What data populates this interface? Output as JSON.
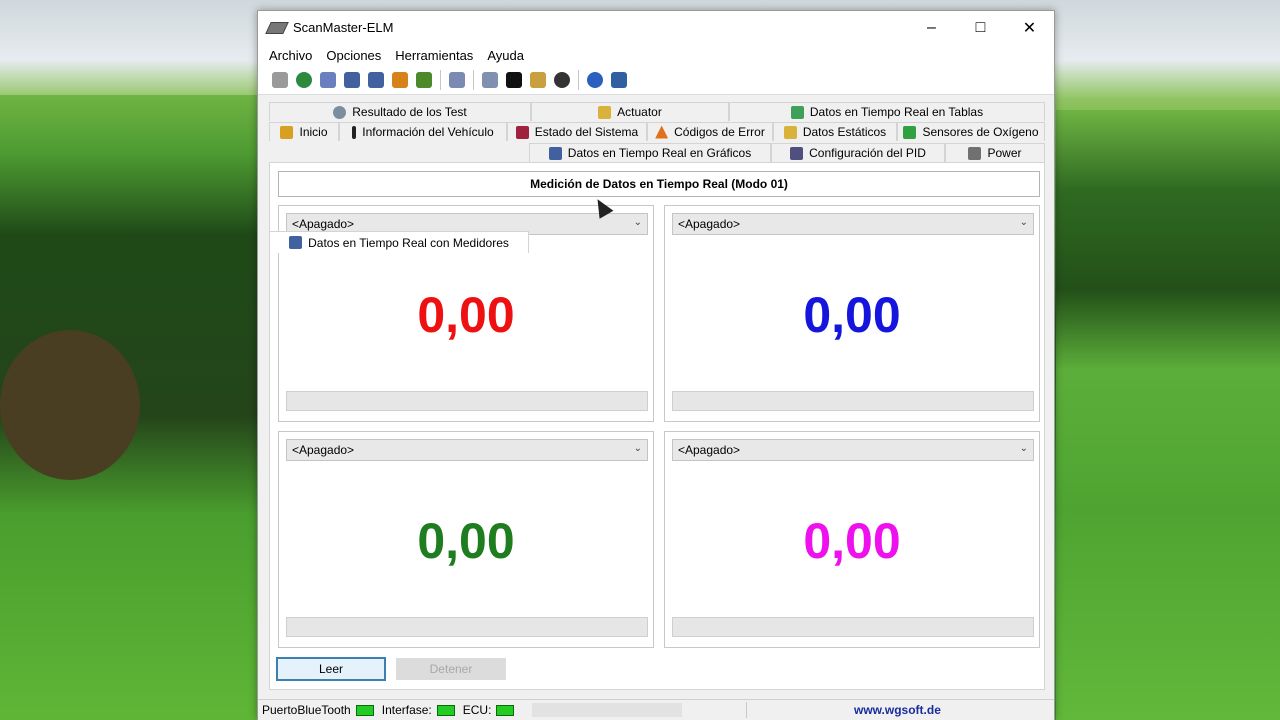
{
  "window": {
    "title": "ScanMaster-ELM",
    "min_label": "–",
    "max_label": "□",
    "close_label": "✕"
  },
  "menu": [
    "Archivo",
    "Opciones",
    "Herramientas",
    "Ayuda"
  ],
  "tabs": [
    {
      "label": "Resultado de los Test",
      "icon": "gear-icon",
      "icon_color": "#7a8ea0"
    },
    {
      "label": "Actuator",
      "icon": "actuator-icon",
      "icon_color": "#d8b23a"
    },
    {
      "label": "Datos en Tiempo Real en Tablas",
      "icon": "table-icon",
      "icon_color": "#3fa05a"
    },
    {
      "label": "Inicio",
      "icon": "home-icon",
      "icon_color": "#d8a020"
    },
    {
      "label": "Información del Vehículo",
      "icon": "info-icon",
      "icon_color": "#222222"
    },
    {
      "label": "Estado del Sistema",
      "icon": "system-icon",
      "icon_color": "#a02040"
    },
    {
      "label": "Códigos de Error",
      "icon": "warning-icon",
      "icon_color": "#e0701c"
    },
    {
      "label": "Datos Estáticos",
      "icon": "static-data-icon",
      "icon_color": "#d8b23a"
    },
    {
      "label": "Sensores de Oxígeno",
      "icon": "oxygen-sensor-icon",
      "icon_color": "#30a040"
    },
    {
      "label": "Datos en Tiempo Real con Medidores",
      "icon": "gauges-icon",
      "icon_color": "#4060a0"
    },
    {
      "label": "Datos en Tiempo Real en Gráficos",
      "icon": "chart-icon",
      "icon_color": "#4060a0"
    },
    {
      "label": "Configuración del PID",
      "icon": "config-icon",
      "icon_color": "#505080"
    },
    {
      "label": "Power",
      "icon": "power-icon",
      "icon_color": "#707070"
    }
  ],
  "main": {
    "header": "Medición de Datos en Tiempo Real (Modo 01)",
    "gauges": [
      {
        "select": "<Apagado>",
        "value": "0,00",
        "color": "#ee1111"
      },
      {
        "select": "<Apagado>",
        "value": "0,00",
        "color": "#1515dd"
      },
      {
        "select": "<Apagado>",
        "value": "0,00",
        "color": "#1e7d1e"
      },
      {
        "select": "<Apagado>",
        "value": "0,00",
        "color": "#ee11ee"
      }
    ],
    "leer_label": "Leer",
    "detener_label": "Detener"
  },
  "status": {
    "bluetooth_label": "PuertoBlueTooth",
    "interface_label": "Interfase:",
    "ecu_label": "ECU:",
    "website": "www.wgsoft.de"
  }
}
